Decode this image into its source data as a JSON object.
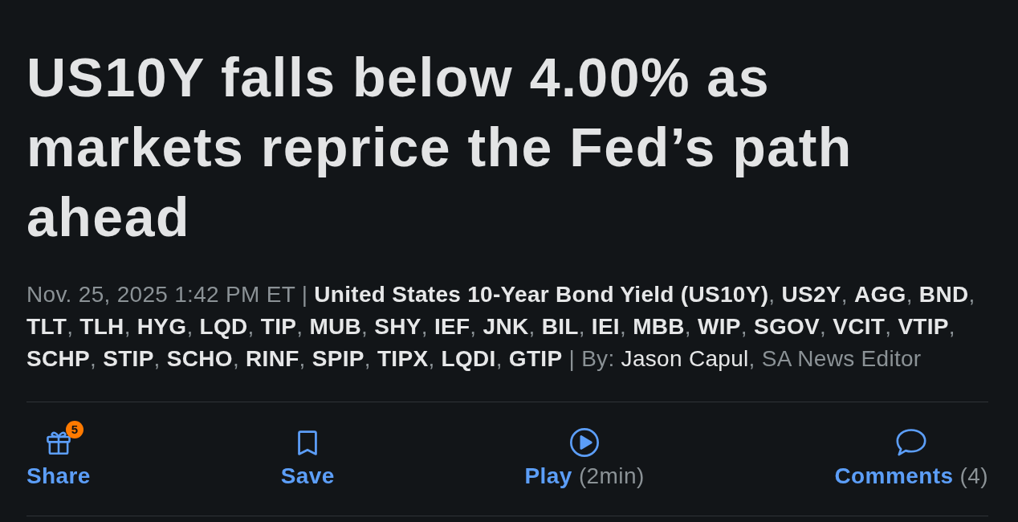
{
  "headline": "US10Y falls below 4.00% as markets reprice the Fed’s path ahead",
  "byline": {
    "date": "Nov. 25, 2025 1:42 PM ET",
    "date_divider": "|",
    "tickers": [
      {
        "symbol": "United States 10-Year Bond Yield (US10Y)",
        "separator": ","
      },
      {
        "symbol": "US2Y",
        "separator": ","
      },
      {
        "symbol": "AGG",
        "separator": ","
      },
      {
        "symbol": "BND",
        "separator": ","
      },
      {
        "symbol": "TLT",
        "separator": ","
      },
      {
        "symbol": "TLH",
        "separator": ","
      },
      {
        "symbol": "HYG",
        "separator": ","
      },
      {
        "symbol": "LQD",
        "separator": ","
      },
      {
        "symbol": "TIP",
        "separator": ","
      },
      {
        "symbol": "MUB",
        "separator": ","
      },
      {
        "symbol": "SHY",
        "separator": ","
      },
      {
        "symbol": "IEF",
        "separator": ","
      },
      {
        "symbol": "JNK",
        "separator": ","
      },
      {
        "symbol": "BIL",
        "separator": ","
      },
      {
        "symbol": "IEI",
        "separator": ","
      },
      {
        "symbol": "MBB",
        "separator": ","
      },
      {
        "symbol": "WIP",
        "separator": ","
      },
      {
        "symbol": "SGOV",
        "separator": ","
      },
      {
        "symbol": "VCIT",
        "separator": ","
      },
      {
        "symbol": "VTIP",
        "separator": ","
      },
      {
        "symbol": "SCHP",
        "separator": ","
      },
      {
        "symbol": "STIP",
        "separator": ","
      },
      {
        "symbol": "SCHO",
        "separator": ","
      },
      {
        "symbol": "RINF",
        "separator": ","
      },
      {
        "symbol": "SPIP",
        "separator": ","
      },
      {
        "symbol": "TIPX",
        "separator": ","
      },
      {
        "symbol": "LQDI",
        "separator": ","
      },
      {
        "symbol": "GTIP"
      }
    ],
    "author_divider": "|",
    "by_label": "By:",
    "author": "Jason Capul",
    "author_separator": ",",
    "author_role": "SA News Editor"
  },
  "actions": [
    {
      "kind": "share",
      "label": "Share",
      "badge": "5"
    },
    {
      "kind": "save",
      "label": "Save"
    },
    {
      "kind": "play",
      "label": "Play",
      "note": "(2min)"
    },
    {
      "kind": "comments",
      "label": "Comments",
      "note": "(4)"
    }
  ]
}
